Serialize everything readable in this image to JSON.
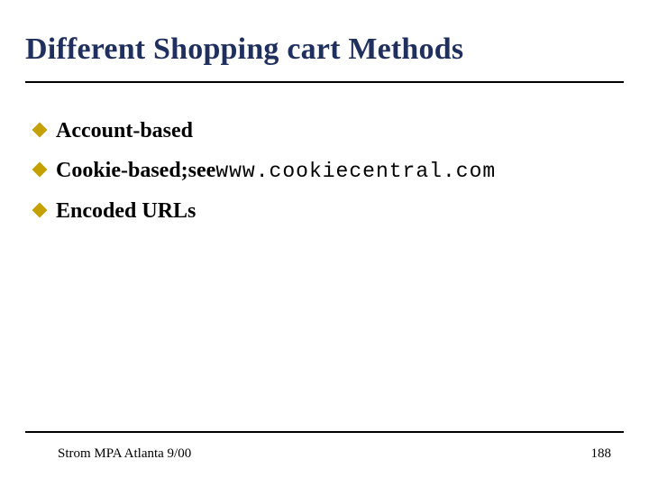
{
  "title": "Different Shopping cart Methods",
  "bullets": [
    {
      "text": "Account-based"
    },
    {
      "text": "Cookie-based;",
      "suffix_plain": " see ",
      "suffix_mono": "www.cookiecentral.com"
    },
    {
      "text": "Encoded URLs"
    }
  ],
  "footer": {
    "left": "Strom MPA Atlanta 9/00",
    "page": "188"
  }
}
